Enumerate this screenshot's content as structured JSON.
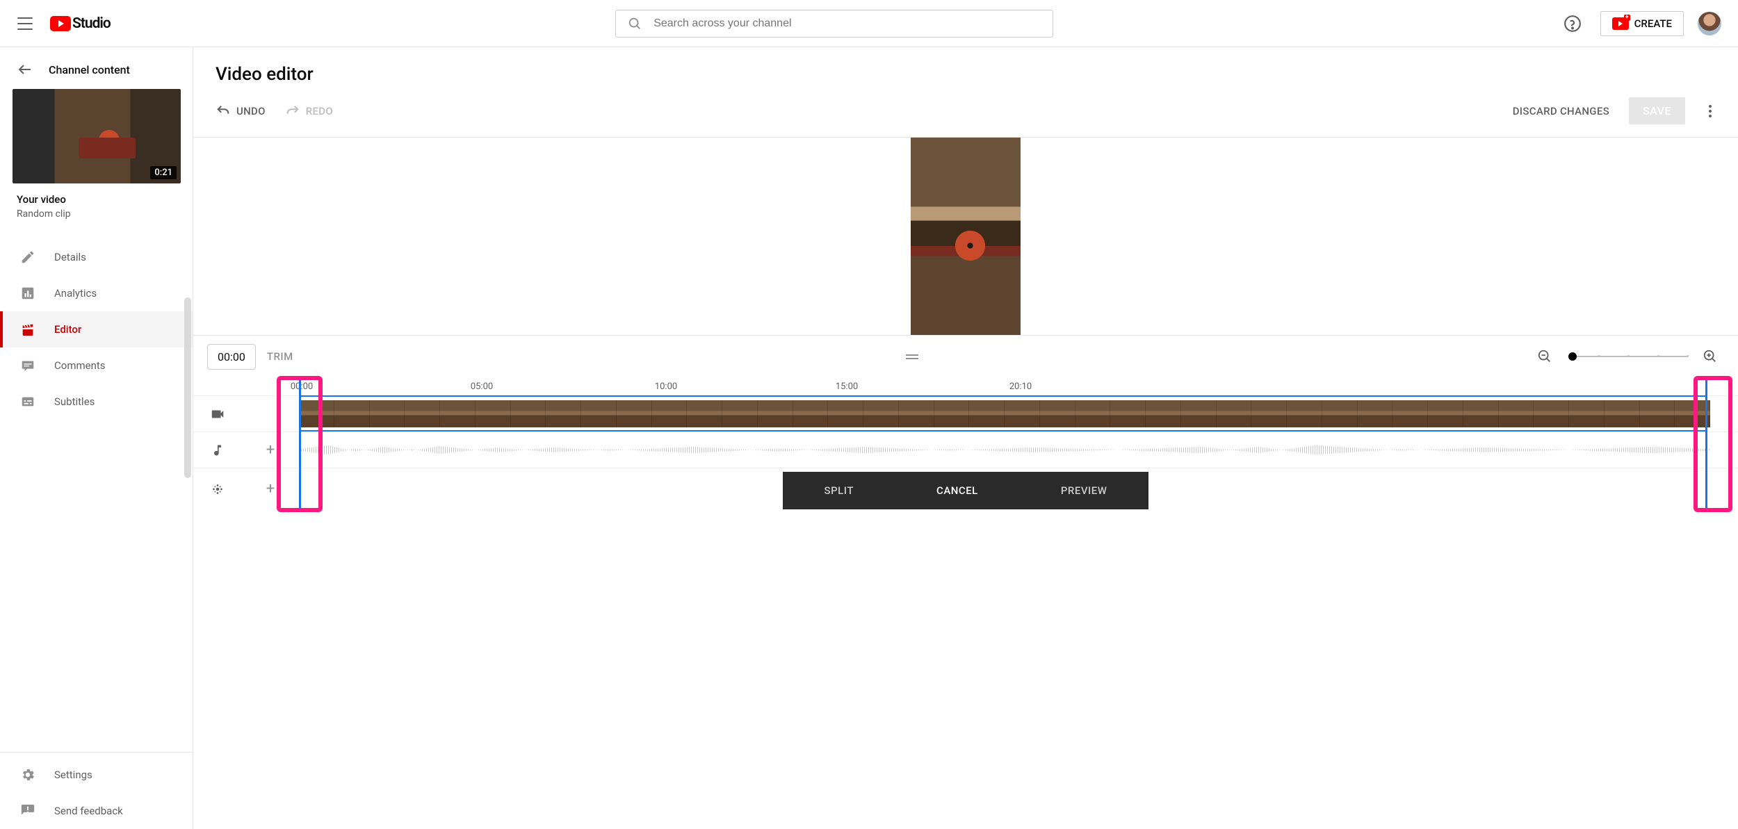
{
  "header": {
    "logo_text": "Studio",
    "search_placeholder": "Search across your channel",
    "create_label": "CREATE"
  },
  "sidebar": {
    "back_label": "Channel content",
    "thumb_duration": "0:21",
    "your_video_label": "Your video",
    "video_title": "Random clip",
    "items": [
      {
        "label": "Details",
        "icon": "pencil",
        "active": false
      },
      {
        "label": "Analytics",
        "icon": "analytics",
        "active": false
      },
      {
        "label": "Editor",
        "icon": "clapper",
        "active": true
      },
      {
        "label": "Comments",
        "icon": "comments",
        "active": false
      },
      {
        "label": "Subtitles",
        "icon": "subtitles",
        "active": false
      }
    ],
    "bottom_items": [
      {
        "label": "Settings",
        "icon": "gear"
      },
      {
        "label": "Send feedback",
        "icon": "feedback"
      }
    ]
  },
  "editor": {
    "page_title": "Video editor",
    "undo": "UNDO",
    "redo": "REDO",
    "discard": "DISCARD CHANGES",
    "save": "SAVE",
    "current_time": "00:00",
    "trim_label": "TRIM",
    "time_markers": [
      "00:00",
      "05:00",
      "10:00",
      "15:00",
      "20:10"
    ],
    "trim_actions": {
      "split": "SPLIT",
      "cancel": "CANCEL",
      "preview": "PREVIEW"
    }
  }
}
